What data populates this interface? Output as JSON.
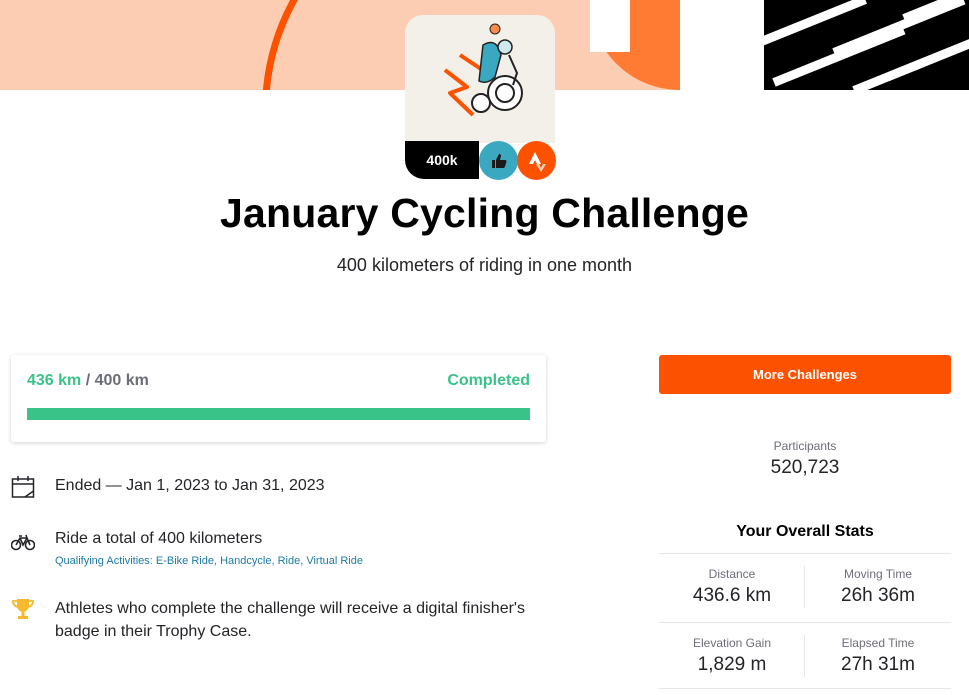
{
  "colors": {
    "brand": "#fc5200",
    "success": "#3ac389",
    "link": "#1d7aa7",
    "banner_peach": "#fccdb3"
  },
  "badge": {
    "goal_label": "400k",
    "icons": [
      "thumbs-up-icon",
      "strava-logo-icon"
    ]
  },
  "challenge": {
    "title": "January Cycling Challenge",
    "subtitle": "400 kilometers of riding in one month"
  },
  "progress": {
    "current": "436 km",
    "separator": " / ",
    "goal": "400 km",
    "status": "Completed",
    "fraction_complete": 1.0
  },
  "details": {
    "dates": "Ended — Jan 1, 2023 to Jan 31, 2023",
    "goal_text": "Ride a total of 400 kilometers",
    "qualifying_label": "Qualifying Activities:",
    "qualifying": [
      "E-Bike Ride",
      "Handcycle",
      "Ride",
      "Virtual Ride"
    ],
    "reward": "Athletes who complete the challenge will receive a digital finisher's badge in their Trophy Case."
  },
  "sidebar": {
    "more_button": "More Challenges",
    "participants_label": "Participants",
    "participants_value": "520,723",
    "stats_title": "Your Overall Stats",
    "stats": [
      {
        "label": "Distance",
        "value": "436.6 km"
      },
      {
        "label": "Moving Time",
        "value": "26h 36m"
      },
      {
        "label": "Elevation Gain",
        "value": "1,829 m"
      },
      {
        "label": "Elapsed Time",
        "value": "27h 31m"
      }
    ]
  }
}
